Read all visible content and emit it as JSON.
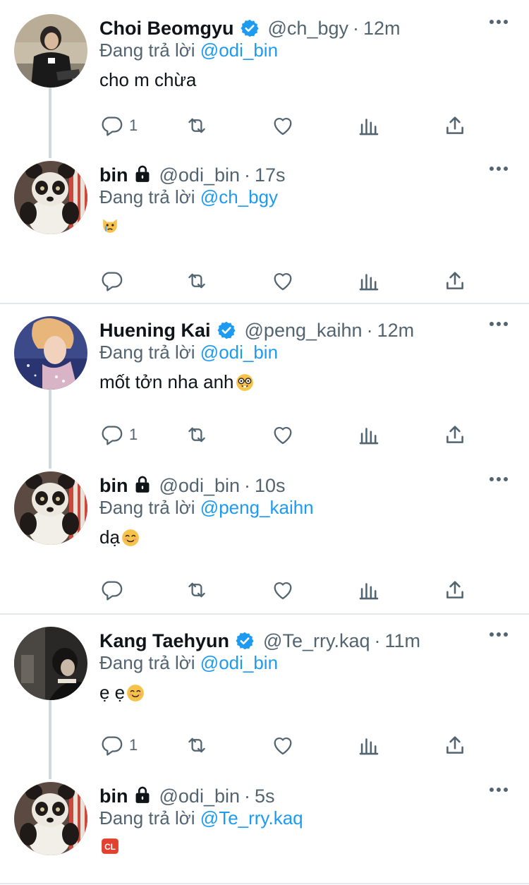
{
  "reply_prefix": "Đang trả lời",
  "colors": {
    "accent": "#1d9bf0",
    "secondary": "#536471",
    "text": "#0f1419"
  },
  "tweets": [
    {
      "name": "Choi Beomgyu",
      "verified": true,
      "handle": "@ch_bgy",
      "time": "12m",
      "reply_to": "@odi_bin",
      "text": "cho m chừa",
      "emoji": "",
      "reply_count": "1",
      "avatar": "beomgyu"
    },
    {
      "name": "bin",
      "locked": true,
      "handle": "@odi_bin",
      "time": "17s",
      "reply_to": "@ch_bgy",
      "text": "",
      "emoji": "crying-cat-icon",
      "reply_count": "",
      "avatar": "panda"
    },
    {
      "name": "Huening Kai",
      "verified": true,
      "handle": "@peng_kaihn",
      "time": "12m",
      "reply_to": "@odi_bin",
      "text": "mốt tởn nha anh",
      "emoji": "nerd-face-icon",
      "reply_count": "1",
      "avatar": "kai"
    },
    {
      "name": "bin",
      "locked": true,
      "handle": "@odi_bin",
      "time": "10s",
      "reply_to": "@peng_kaihn",
      "text": "dạ",
      "emoji": "smiling-face-icon",
      "reply_count": "",
      "avatar": "panda"
    },
    {
      "name": "Kang Taehyun",
      "verified": true,
      "handle": "@Te_rry.kaq",
      "time": "11m",
      "reply_to": "@odi_bin",
      "text": "ẹ ẹ",
      "emoji": "blush-face-icon",
      "reply_count": "1",
      "avatar": "taehyun"
    },
    {
      "name": "bin",
      "locked": true,
      "handle": "@odi_bin",
      "time": "5s",
      "reply_to": "@Te_rry.kaq",
      "text": "",
      "emoji": "cl-button-icon",
      "emoji_text": "CL",
      "reply_count": "",
      "avatar": "panda"
    }
  ]
}
